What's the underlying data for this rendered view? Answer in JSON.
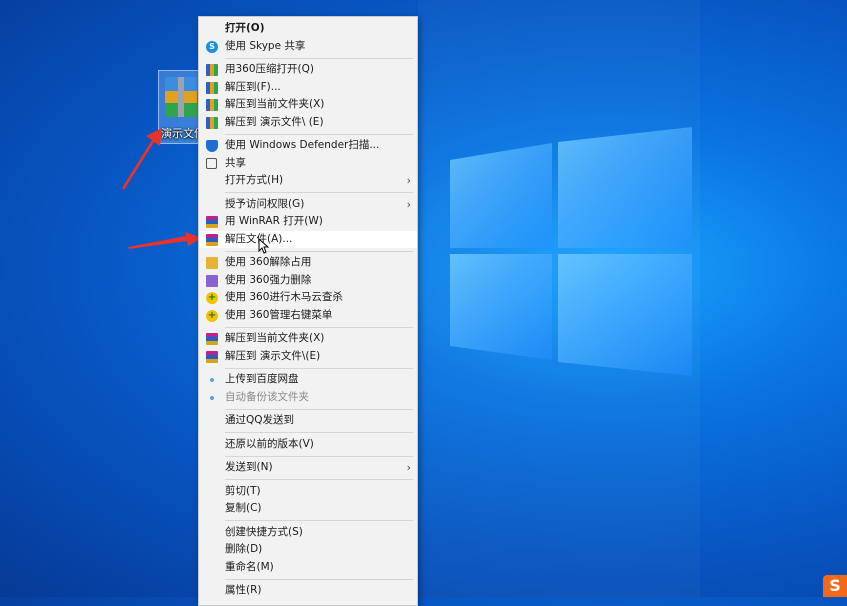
{
  "desktop": {
    "icon_label": "演示文件"
  },
  "menu": {
    "items": [
      {
        "label": "打开(O)",
        "icon": "none",
        "bold": true
      },
      {
        "label": "使用 Skype 共享",
        "icon": "skype-icon"
      },
      {
        "sep": true
      },
      {
        "label": "用360压缩打开(Q)",
        "icon": "archive-icon"
      },
      {
        "label": "解压到(F)...",
        "icon": "archive-icon"
      },
      {
        "label": "解压到当前文件夹(X)",
        "icon": "archive-icon"
      },
      {
        "label": "解压到 演示文件\\ (E)",
        "icon": "archive-icon"
      },
      {
        "sep": true
      },
      {
        "label": "使用 Windows Defender扫描...",
        "icon": "defender-shield-icon"
      },
      {
        "label": "共享",
        "icon": "share-icon"
      },
      {
        "label": "打开方式(H)",
        "icon": "none",
        "submenu": true
      },
      {
        "sep": true
      },
      {
        "label": "授予访问权限(G)",
        "icon": "none",
        "submenu": true
      },
      {
        "label": "用 WinRAR 打开(W)",
        "icon": "winrar-icon"
      },
      {
        "label": "解压文件(A)...",
        "icon": "winrar-icon",
        "hover": true
      },
      {
        "sep": true
      },
      {
        "label": "使用 360解除占用",
        "icon": "folder-icon"
      },
      {
        "label": "使用 360强力删除",
        "icon": "shredder-icon"
      },
      {
        "label": "使用 360进行木马云查杀",
        "icon": "360-icon"
      },
      {
        "label": "使用 360管理右键菜单",
        "icon": "360-icon"
      },
      {
        "sep": true
      },
      {
        "label": "解压到当前文件夹(X)",
        "icon": "winrar-icon"
      },
      {
        "label": "解压到 演示文件\\(E)",
        "icon": "winrar-icon"
      },
      {
        "sep": true
      },
      {
        "label": "上传到百度网盘",
        "icon": "baidu-cloud-icon"
      },
      {
        "label": "自动备份该文件夹",
        "icon": "baidu-cloud-icon",
        "gray": true
      },
      {
        "sep": true
      },
      {
        "label": "通过QQ发送到",
        "icon": "none"
      },
      {
        "sep": true
      },
      {
        "label": "还原以前的版本(V)",
        "icon": "none"
      },
      {
        "sep": true
      },
      {
        "label": "发送到(N)",
        "icon": "none",
        "submenu": true
      },
      {
        "sep": true
      },
      {
        "label": "剪切(T)",
        "icon": "none"
      },
      {
        "label": "复制(C)",
        "icon": "none"
      },
      {
        "sep": true
      },
      {
        "label": "创建快捷方式(S)",
        "icon": "none"
      },
      {
        "label": "删除(D)",
        "icon": "none"
      },
      {
        "label": "重命名(M)",
        "icon": "none"
      },
      {
        "sep": true
      },
      {
        "label": "属性(R)",
        "icon": "none"
      }
    ],
    "submenu_glyph": "›"
  },
  "tray": {
    "ime_glyph": "S"
  },
  "colors": {
    "annotation_arrow": "#e8332b",
    "menu_background": "#f2f2f2",
    "hover_background": "#ffffff"
  }
}
